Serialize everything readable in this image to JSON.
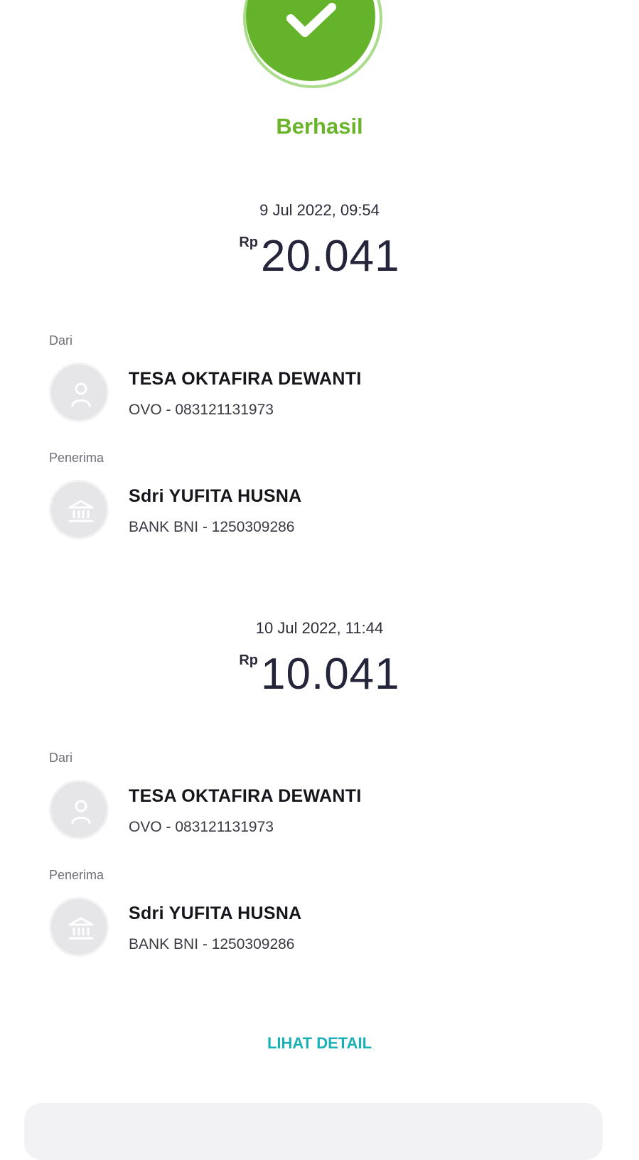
{
  "status": {
    "label": "Berhasil",
    "color": "#65b32a"
  },
  "transactions": [
    {
      "datetime": "9 Jul 2022, 09:54",
      "currency": "Rp",
      "amount": "20.041",
      "from_label": "Dari",
      "from": {
        "name": "TESA OKTAFIRA DEWANTI",
        "account": "OVO - 083121131973",
        "icon": "user-icon"
      },
      "to_label": "Penerima",
      "to": {
        "name": "Sdri YUFITA HUSNA",
        "account": "BANK BNI - 1250309286",
        "icon": "bank-icon"
      }
    },
    {
      "datetime": "10 Jul 2022, 11:44",
      "currency": "Rp",
      "amount": "10.041",
      "from_label": "Dari",
      "from": {
        "name": "TESA OKTAFIRA DEWANTI",
        "account": "OVO - 083121131973",
        "icon": "user-icon"
      },
      "to_label": "Penerima",
      "to": {
        "name": "Sdri YUFITA HUSNA",
        "account": "BANK BNI - 1250309286",
        "icon": "bank-icon"
      }
    }
  ],
  "detail_link": {
    "label": "LIHAT DETAIL",
    "color": "#1ab0b8"
  }
}
